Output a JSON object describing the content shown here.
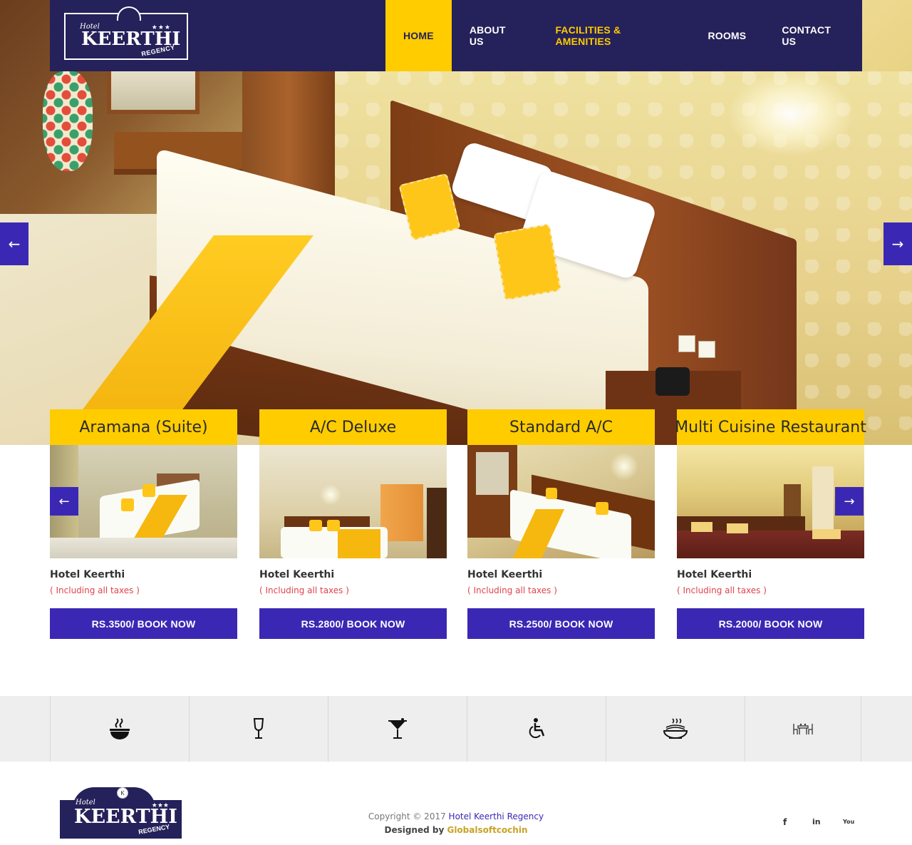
{
  "brand": {
    "hotel_word": "Hotel",
    "name": "KEERTHI",
    "stars": "★★★",
    "sub": "REGENCY",
    "badge": "K"
  },
  "nav": {
    "items": [
      {
        "label": "HOME",
        "state": "active"
      },
      {
        "label": "ABOUT US",
        "state": "normal"
      },
      {
        "label": "FACILITIES & AMENITIES",
        "state": "highlight"
      },
      {
        "label": "ROOMS",
        "state": "normal"
      },
      {
        "label": "CONTACT US",
        "state": "normal"
      }
    ]
  },
  "slider": {
    "prev_icon": "←",
    "next_icon": "→"
  },
  "rooms": [
    {
      "title": "Aramana (Suite)",
      "hotel": "Hotel Keerthi",
      "tax_note": "( Including all taxes )",
      "button": "RS.3500/ BOOK NOW"
    },
    {
      "title": "A/C Deluxe",
      "hotel": "Hotel Keerthi",
      "tax_note": "( Including all taxes )",
      "button": "RS.2800/ BOOK NOW"
    },
    {
      "title": "Standard A/C",
      "hotel": "Hotel Keerthi",
      "tax_note": "( Including all taxes )",
      "button": "RS.2500/ BOOK NOW"
    },
    {
      "title": "Multi Cuisine Restaurant",
      "hotel": "Hotel Keerthi",
      "tax_note": "( Including all taxes )",
      "button": "RS.2000/ BOOK NOW"
    }
  ],
  "carousel": {
    "prev_icon": "←",
    "next_icon": "→"
  },
  "facilities": [
    {
      "icon": "hot-soup-icon"
    },
    {
      "icon": "wine-glass-icon"
    },
    {
      "icon": "cocktail-icon"
    },
    {
      "icon": "wheelchair-icon"
    },
    {
      "icon": "noodles-bowl-icon"
    },
    {
      "icon": "dining-table-icon"
    }
  ],
  "footer": {
    "copyright_prefix": "Copyright © 2017 ",
    "copyright_link": "Hotel Keerthi Regency",
    "designed_prefix": "Designed by ",
    "designed_link": "Globalsoftcochin",
    "social": {
      "facebook": "f",
      "linkedin": "in",
      "youtube": "You"
    }
  },
  "colors": {
    "nav_bg": "#25215a",
    "accent_yellow": "#ffcc00",
    "button_blue": "#3a28b5",
    "tax_red": "#e0434b",
    "facility_bg": "#eeeeee"
  }
}
